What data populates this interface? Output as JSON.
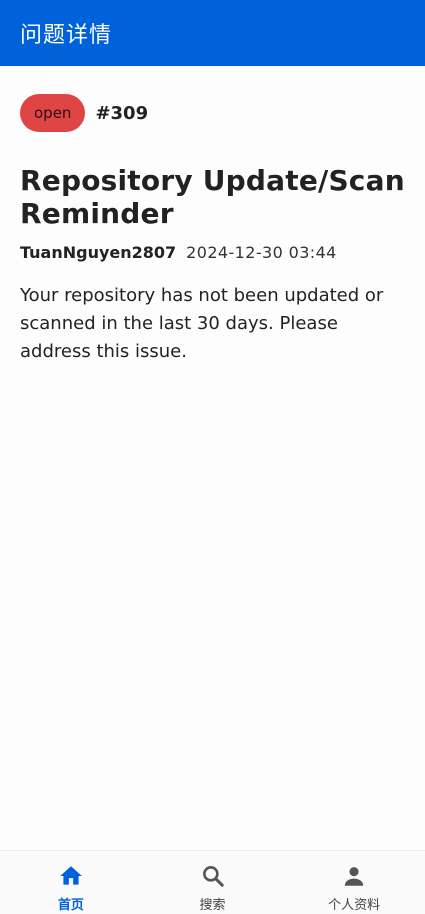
{
  "app_bar": {
    "title": "问题详情"
  },
  "issue": {
    "status": "open",
    "number": "#309",
    "title": "Repository Update/Scan Reminder",
    "author": "TuanNguyen2807",
    "timestamp": "2024-12-30 03:44",
    "body": "Your repository has not been updated or scanned in the last 30 days. Please address this issue."
  },
  "bottom_nav": {
    "items": [
      {
        "label": "首页",
        "icon": "home-icon",
        "active": true
      },
      {
        "label": "搜索",
        "icon": "search-icon",
        "active": false
      },
      {
        "label": "个人资料",
        "icon": "person-icon",
        "active": false
      }
    ]
  },
  "colors": {
    "primary": "#0062db",
    "status_open": "#e04545"
  }
}
